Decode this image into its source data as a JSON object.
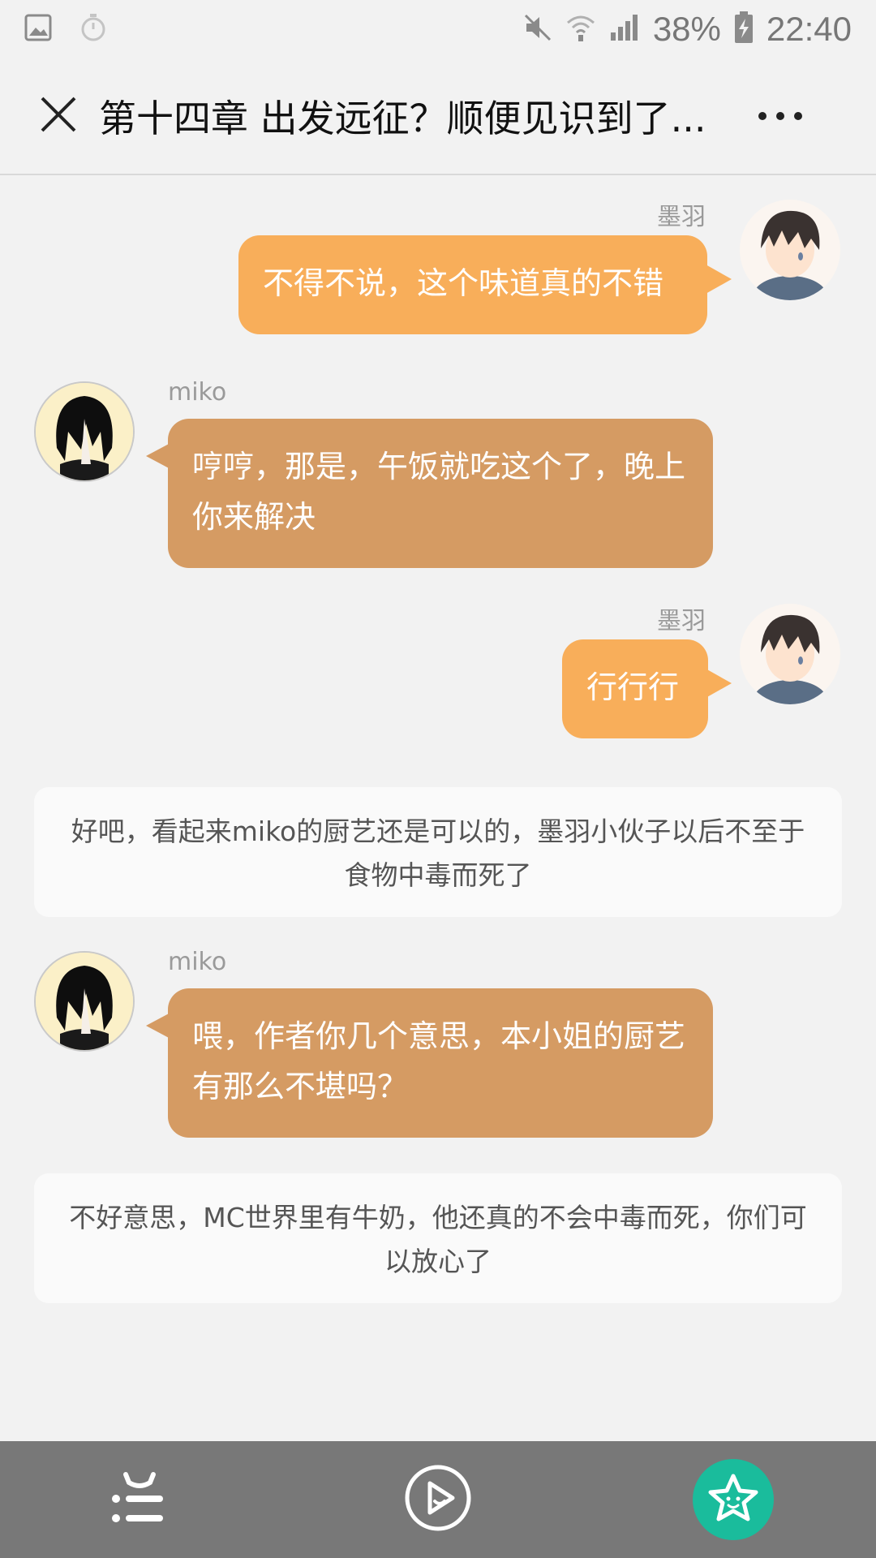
{
  "status_bar": {
    "battery": "38%",
    "time": "22:40",
    "icons": [
      "image-icon",
      "timer-icon",
      "mute-icon",
      "wifi-icon",
      "signal-icon",
      "battery-charging-icon"
    ]
  },
  "header": {
    "title": "第十四章 出发远征？顺便见识到了...",
    "close_icon": "close-icon",
    "more_icon": "more-icon"
  },
  "messages": [
    {
      "type": "right",
      "speaker": "墨羽",
      "text": "不得不说，这个味道真的不错"
    },
    {
      "type": "left",
      "speaker": "miko",
      "text": "哼哼，那是，午饭就吃这个了，晚上你来解决"
    },
    {
      "type": "right",
      "speaker": "墨羽",
      "text": "行行行"
    },
    {
      "type": "narration",
      "text": "好吧，看起来miko的厨艺还是可以的，墨羽小伙子以后不至于食物中毒而死了"
    },
    {
      "type": "left",
      "speaker": "miko",
      "text": "喂，作者你几个意思，本小姐的厨艺有那么不堪吗？"
    },
    {
      "type": "narration",
      "text": "不好意思，MC世界里有牛奶，他还真的不会中毒而死，你们可以放心了"
    }
  ],
  "bottom_bar": {
    "icons": [
      "menu-face-icon",
      "play-icon",
      "favorite-star-icon"
    ]
  },
  "colors": {
    "right_bubble": "#f8ae5a",
    "left_bubble": "#d59b63",
    "accent_green": "#1abc9c",
    "bottom_bar": "#787878"
  }
}
